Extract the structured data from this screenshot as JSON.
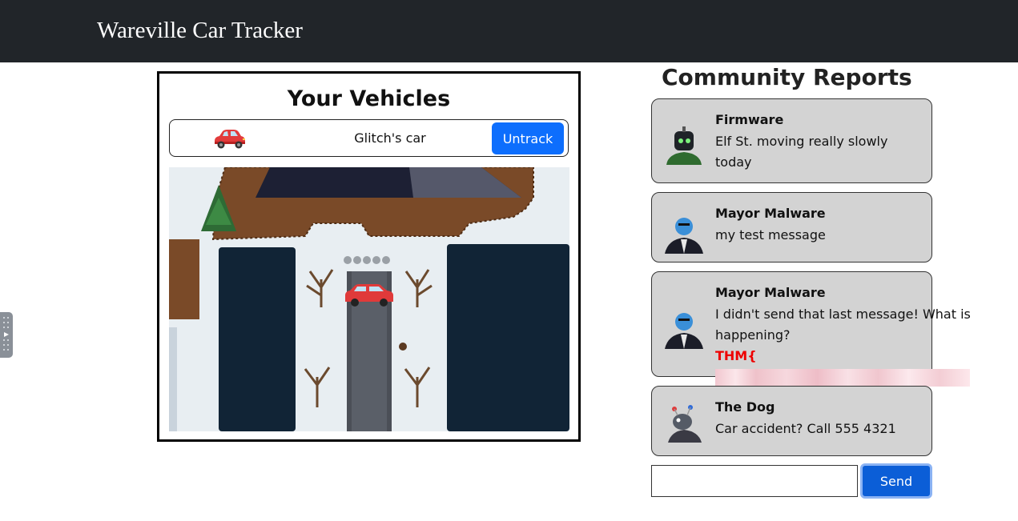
{
  "app": {
    "title": "Wareville Car Tracker"
  },
  "vehicles": {
    "heading": "Your Vehicles",
    "items": [
      {
        "name": "Glitch's car",
        "action_label": "Untrack",
        "icon": "red-car-icon"
      }
    ],
    "map_image": "winter-village-map"
  },
  "reports": {
    "heading": "Community Reports",
    "items": [
      {
        "author": "Firmware",
        "message": "Elf St. moving really slowly today",
        "avatar": "robot-avatar"
      },
      {
        "author": "Mayor Malware",
        "message": "my test message",
        "avatar": "mayor-malware-avatar"
      },
      {
        "author": "Mayor Malware",
        "message": "I didn't send that last message! What is happening?",
        "flag_prefix": "THM{",
        "flag_suffix": "}",
        "avatar": "mayor-malware-avatar"
      },
      {
        "author": "The Dog",
        "message": "Car accident? Call 555 4321",
        "avatar": "dog-avatar"
      }
    ]
  },
  "composer": {
    "value": "",
    "send_label": "Send"
  },
  "colors": {
    "navbar": "#212529",
    "primary": "#0d6efd",
    "report_bg": "#d3d3d3",
    "flag": "#ee0000"
  }
}
